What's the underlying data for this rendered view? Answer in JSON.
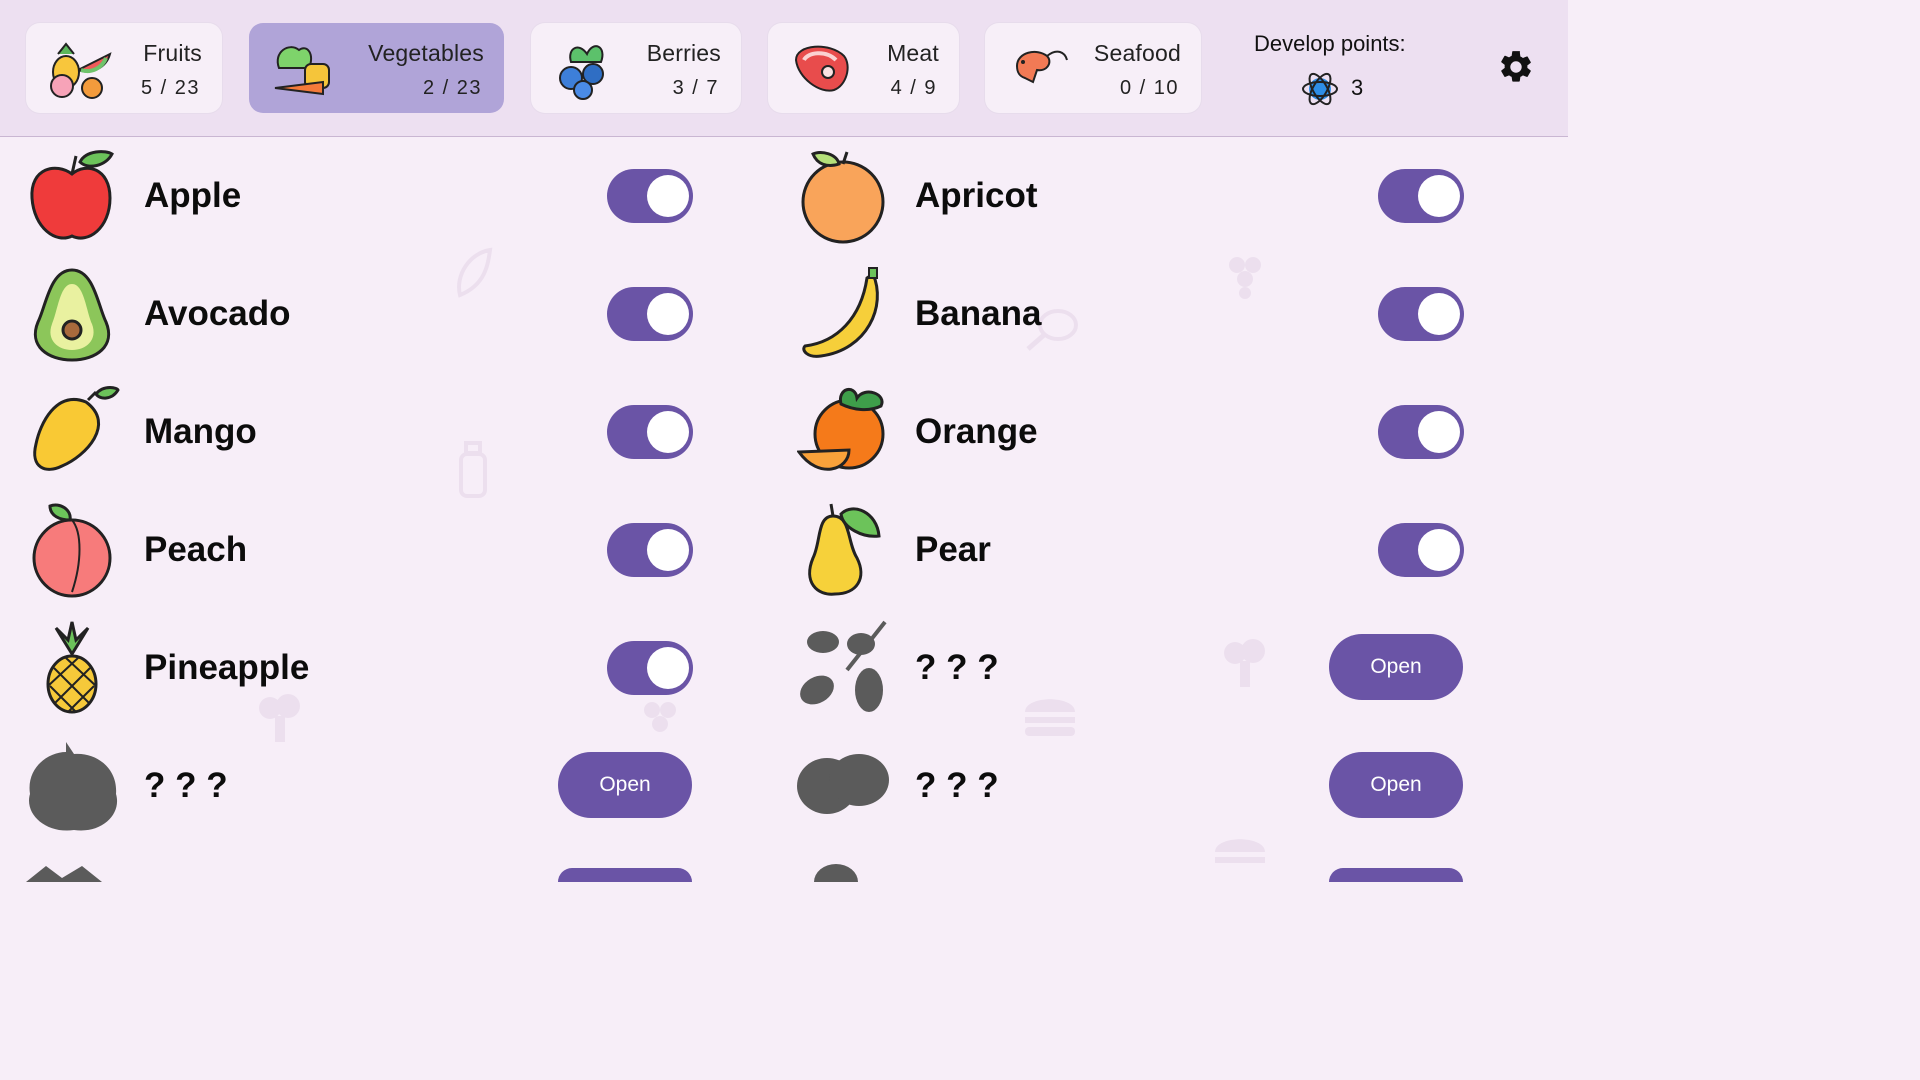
{
  "tabs": [
    {
      "name": "Fruits",
      "count": "5 / 23",
      "icon": "fruit-basket-icon",
      "selected": false
    },
    {
      "name": "Vegetables",
      "count": "2 / 23",
      "icon": "vegetables-icon",
      "selected": true
    },
    {
      "name": "Berries",
      "count": "3 / 7",
      "icon": "blueberries-icon",
      "selected": false
    },
    {
      "name": "Meat",
      "count": "4 / 9",
      "icon": "steak-icon",
      "selected": false
    },
    {
      "name": "Seafood",
      "count": "0 / 10",
      "icon": "shrimp-icon",
      "selected": false
    }
  ],
  "develop": {
    "label": "Develop points:",
    "value": "3",
    "icon": "atom-icon"
  },
  "settings_icon": "gear-icon",
  "colors": {
    "accent": "#6a54a6",
    "header_bg": "#ede0f1",
    "page_bg": "#f7eef8",
    "selected_tab": "#b0a4d8"
  },
  "items": [
    {
      "name": "Apple",
      "icon": "apple-icon",
      "unlocked": true
    },
    {
      "name": "Apricot",
      "icon": "apricot-icon",
      "unlocked": true
    },
    {
      "name": "Avocado",
      "icon": "avocado-icon",
      "unlocked": true
    },
    {
      "name": "Banana",
      "icon": "banana-icon",
      "unlocked": true
    },
    {
      "name": "Mango",
      "icon": "mango-icon",
      "unlocked": true
    },
    {
      "name": "Orange",
      "icon": "orange-icon",
      "unlocked": true
    },
    {
      "name": "Peach",
      "icon": "peach-icon",
      "unlocked": true
    },
    {
      "name": "Pear",
      "icon": "pear-icon",
      "unlocked": true
    },
    {
      "name": "Pineapple",
      "icon": "pineapple-icon",
      "unlocked": true
    },
    {
      "name": "? ? ?",
      "icon": "locked-olives-silhouette-icon",
      "unlocked": false,
      "button": "Open"
    },
    {
      "name": "? ? ?",
      "icon": "locked-durian-silhouette-icon",
      "unlocked": false,
      "button": "Open"
    },
    {
      "name": "? ? ?",
      "icon": "locked-kiwi-silhouette-icon",
      "unlocked": false,
      "button": "Open"
    }
  ]
}
